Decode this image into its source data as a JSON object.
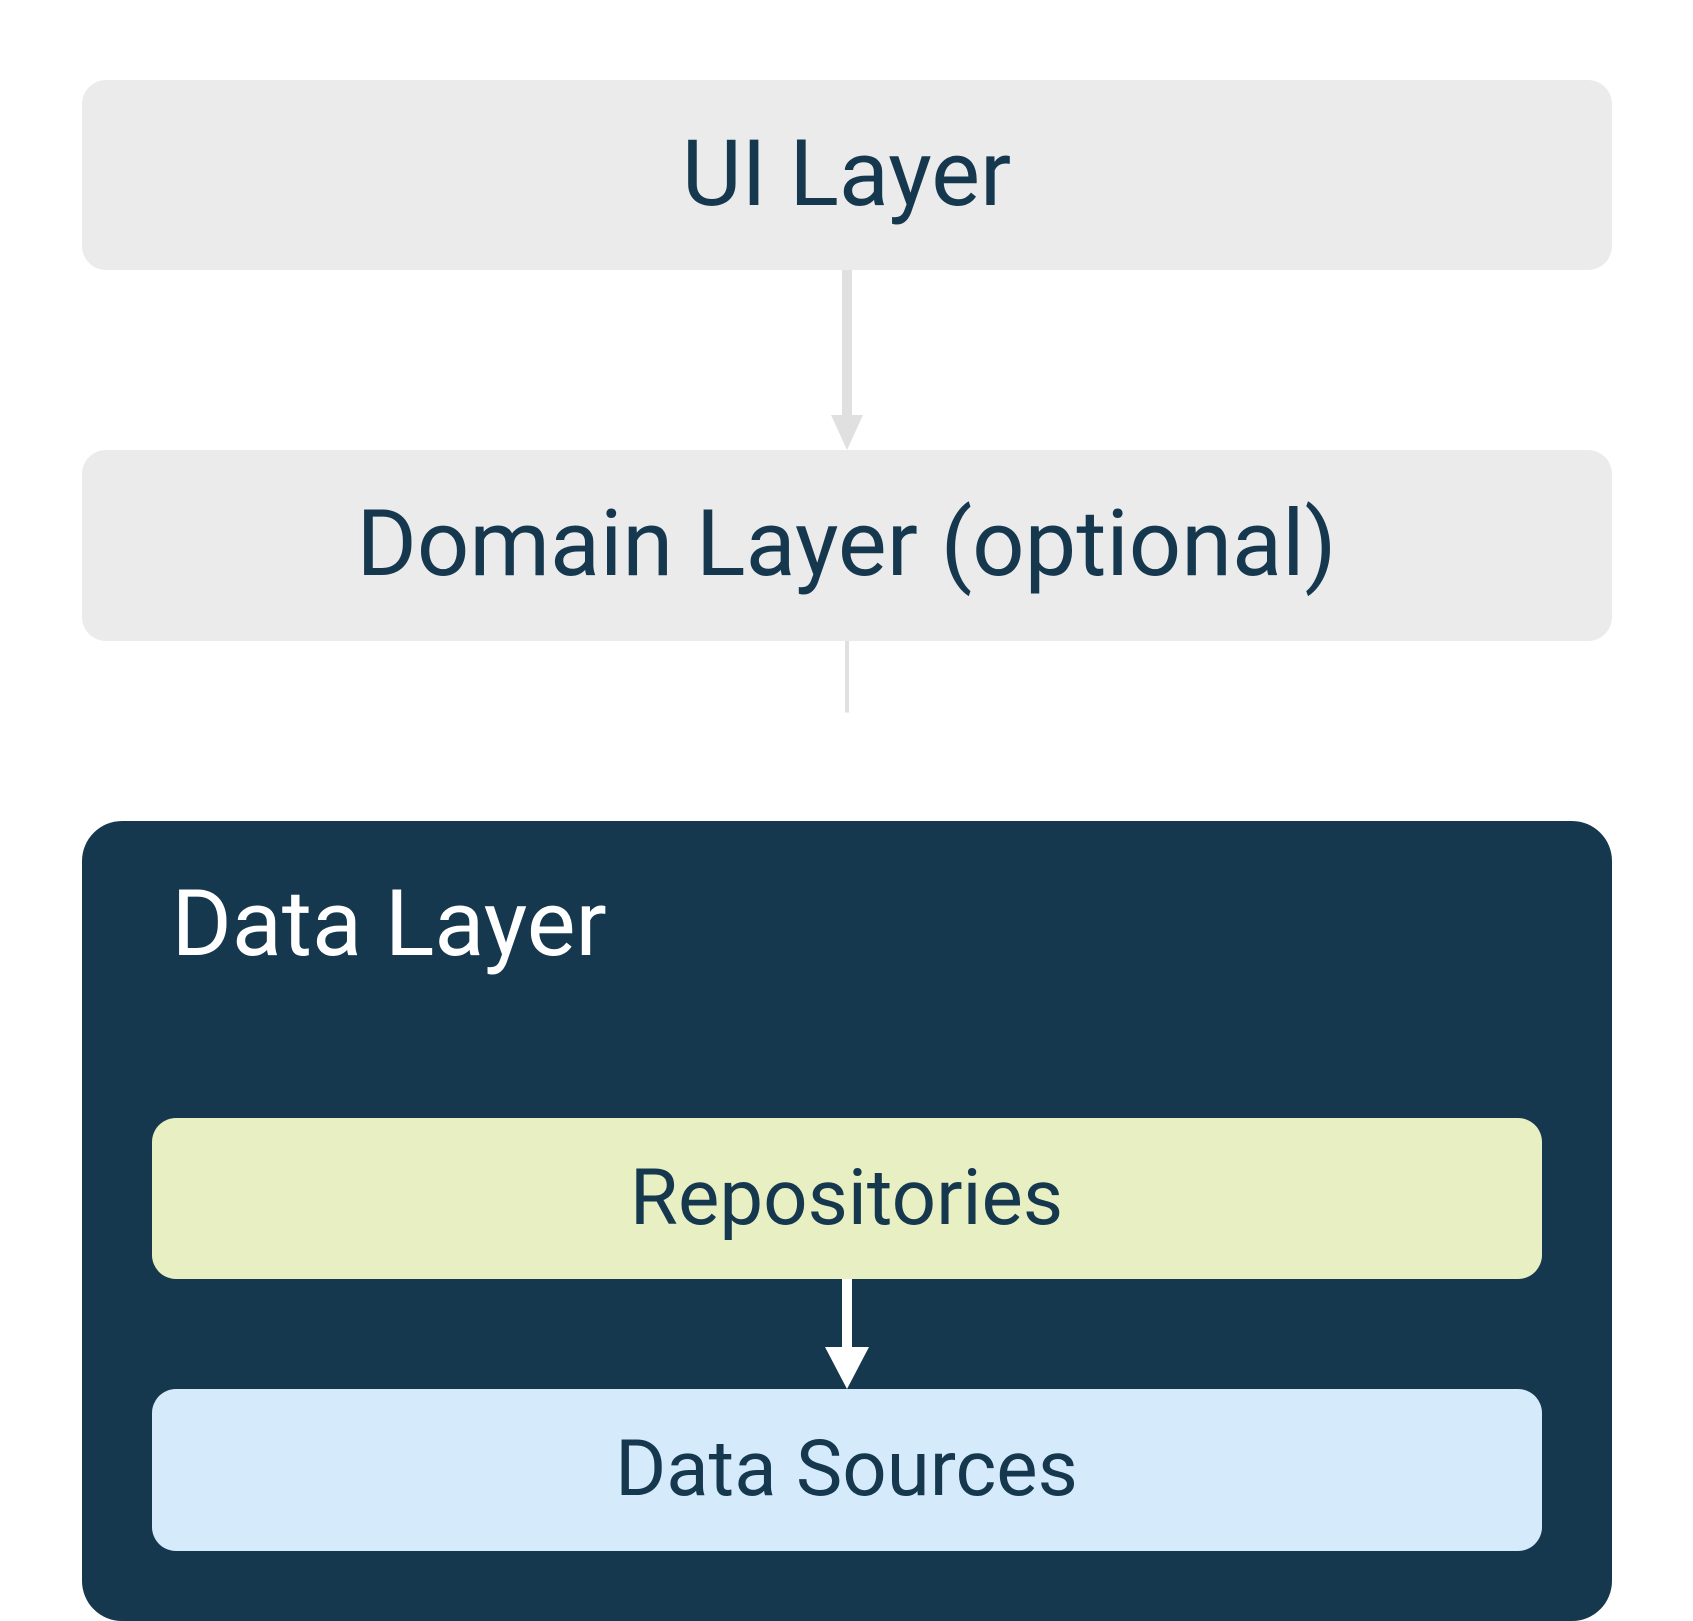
{
  "diagram": {
    "layers": {
      "ui": "UI Layer",
      "domain": "Domain Layer (optional)",
      "data": {
        "title": "Data Layer",
        "repositories": "Repositories",
        "dataSources": "Data Sources"
      }
    },
    "colors": {
      "lightGray": "#ebebeb",
      "darkNavy": "#16384f",
      "lightGreen": "#e8f0c3",
      "lightBlue": "#d5ebfb",
      "arrowLight": "#e0e0e0",
      "arrowWhite": "#ffffff"
    }
  }
}
